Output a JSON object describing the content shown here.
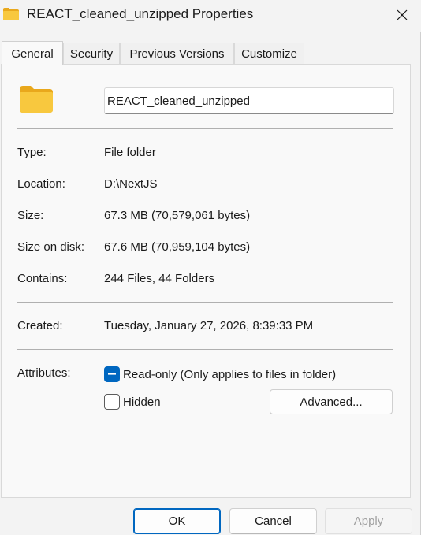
{
  "window": {
    "title": "REACT_cleaned_unzipped Properties",
    "icon": "folder-icon"
  },
  "tabs": [
    {
      "label": "General",
      "active": true
    },
    {
      "label": "Security",
      "active": false
    },
    {
      "label": "Previous Versions",
      "active": false
    },
    {
      "label": "Customize",
      "active": false
    }
  ],
  "general": {
    "folder_name": "REACT_cleaned_unzipped",
    "rows": [
      {
        "label": "Type:",
        "value": "File folder"
      },
      {
        "label": "Location:",
        "value": "D:\\NextJS"
      },
      {
        "label": "Size:",
        "value": "67.3 MB (70,579,061 bytes)"
      },
      {
        "label": "Size on disk:",
        "value": "67.6 MB (70,959,104 bytes)"
      },
      {
        "label": "Contains:",
        "value": "244 Files, 44 Folders"
      }
    ],
    "created": {
      "label": "Created:",
      "value": "Tuesday, January 27, 2026, 8:39:33 PM"
    },
    "attributes": {
      "label": "Attributes:",
      "read_only": {
        "label": "Read-only (Only applies to files in folder)",
        "state": "indeterminate"
      },
      "hidden": {
        "label": "Hidden",
        "state": "unchecked"
      },
      "advanced_label": "Advanced..."
    }
  },
  "footer": {
    "ok_label": "OK",
    "cancel_label": "Cancel",
    "apply_label": "Apply"
  },
  "colors": {
    "accent": "#0067c0",
    "folder": "#f8c83e",
    "folder_dark": "#e9a81c"
  }
}
